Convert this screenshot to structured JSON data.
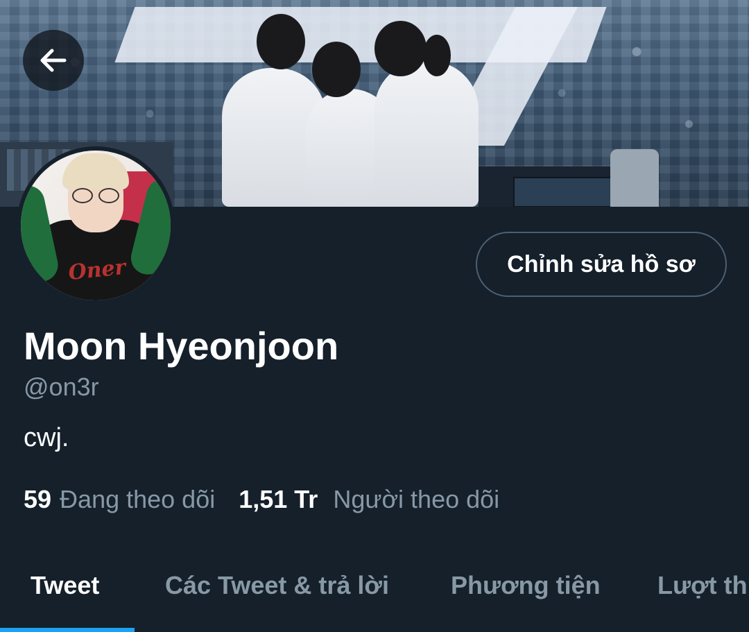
{
  "header": {
    "back_icon": "arrow-left-icon"
  },
  "profile": {
    "display_name": "Moon Hyeonjoon",
    "handle": "@on3r",
    "bio": "cwj.",
    "edit_button_label": "Chỉnh sửa hồ sơ",
    "avatar_shirt_text": "Oner"
  },
  "stats": {
    "following_count": "59",
    "following_label": "Đang theo dõi",
    "followers_count": "1,51 Tr",
    "followers_label": "Người theo dõi"
  },
  "tabs": [
    {
      "label": "Tweet",
      "active": true
    },
    {
      "label": "Các Tweet & trả lời",
      "active": false
    },
    {
      "label": "Phương tiện",
      "active": false
    },
    {
      "label": "Lượt thích",
      "active": false
    }
  ],
  "colors": {
    "background": "#15202b",
    "accent": "#1da1f2",
    "secondary_text": "#8899a6",
    "primary_text": "#ffffff"
  }
}
